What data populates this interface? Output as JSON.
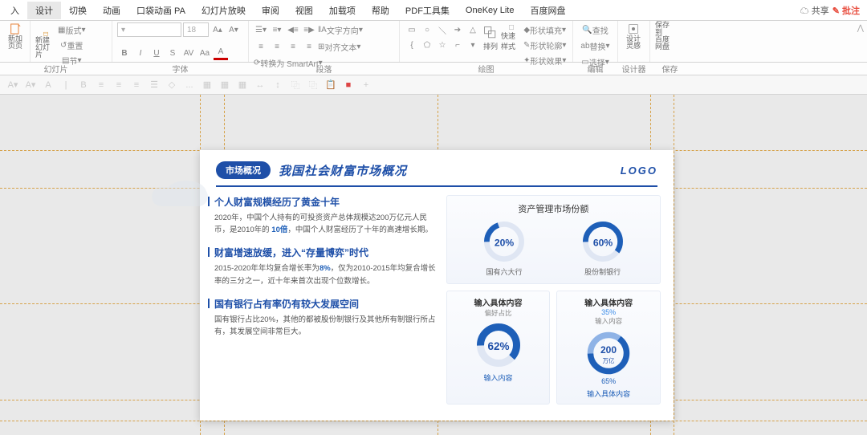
{
  "menu": {
    "items": [
      "入",
      "设计",
      "切换",
      "动画",
      "口袋动画 PA",
      "幻灯片放映",
      "审阅",
      "视图",
      "加载项",
      "帮助",
      "PDF工具集",
      "OneKey Lite",
      "百度网盘"
    ],
    "share": "共享",
    "annotate": "批注"
  },
  "ribbon": {
    "groups": {
      "slides": "幻灯片",
      "font": "字体",
      "paragraph": "段落",
      "drawing": "绘图",
      "editing": "编辑",
      "designer": "设计器",
      "save": "保存"
    },
    "newSlide": "新加\n页页",
    "layout": "新建\n幻灯片",
    "format": "版式",
    "section": "节",
    "reset": "重置",
    "fontSize": "18",
    "biu": [
      "B",
      "I",
      "U",
      "S"
    ],
    "av": "AV",
    "aa": "Aa",
    "textdir": "文字方向",
    "align": "对齐文本",
    "smartart": "转换为 SmartArt",
    "arrange": "排列",
    "quick": "快速样式",
    "shapefill": "形状填充",
    "shapeoutline": "形状轮廓",
    "shapeeffect": "形状效果",
    "find": "查找",
    "replace": "替换",
    "select": "选择",
    "design": "设计\n灵感",
    "savebd": "保存到\n百度网盘"
  },
  "slide": {
    "badge": "市场概况",
    "title": "我国社会财富市场概况",
    "logo": "LOGO",
    "sec1": {
      "title": "个人财富规模经历了黄金十年",
      "text_a": "2020年，中国个人持有的可投资资产总体规模达200万亿元人民币，是2010年的 ",
      "hl": "10倍",
      "text_b": "，中国个人财富经历了十年的高速增长期。"
    },
    "sec2": {
      "title": "财富增速放缓，进入“存量博弈”时代",
      "text_a": "2015-2020年年均复合增长率为",
      "hl": "8%",
      "text_b": "，仅为2010-2015年均复合增长率的三分之一，近十年来首次出现个位数增长。"
    },
    "sec3": {
      "title": "国有银行占有率仍有较大发展空间",
      "text": "国有银行占比20%，其他的都被股份制银行及其他所有制银行所占有，其发展空间非常巨大。"
    },
    "card1": {
      "title": "资产管理市场份额"
    },
    "card2": {
      "title": "输入具体内容",
      "sub": "偏好占比",
      "bottom": "输入内容"
    },
    "card3": {
      "title": "输入具体内容",
      "top": "输入内容",
      "bottom": "输入具体内容"
    }
  },
  "chart_data": [
    {
      "type": "pie",
      "title": "资产管理市场份额",
      "series": [
        {
          "name": "国有六大行",
          "values": [
            20
          ]
        },
        {
          "name": "股份制银行",
          "values": [
            60
          ]
        }
      ],
      "labels": [
        "国有六大行",
        "股份制银行"
      ],
      "values_display": [
        "20%",
        "60%"
      ]
    },
    {
      "type": "pie",
      "title": "输入具体内容 偏好占比",
      "categories": [
        "输入内容"
      ],
      "values": [
        62
      ],
      "values_display": [
        "62%"
      ]
    },
    {
      "type": "pie",
      "title": "输入具体内容",
      "series": [
        {
          "name": "输入内容",
          "values": [
            35
          ]
        },
        {
          "name": "输入具体内容",
          "values": [
            65
          ]
        }
      ],
      "center_value": "200",
      "center_unit": "万亿",
      "values_display": [
        "35%",
        "65%"
      ]
    }
  ]
}
